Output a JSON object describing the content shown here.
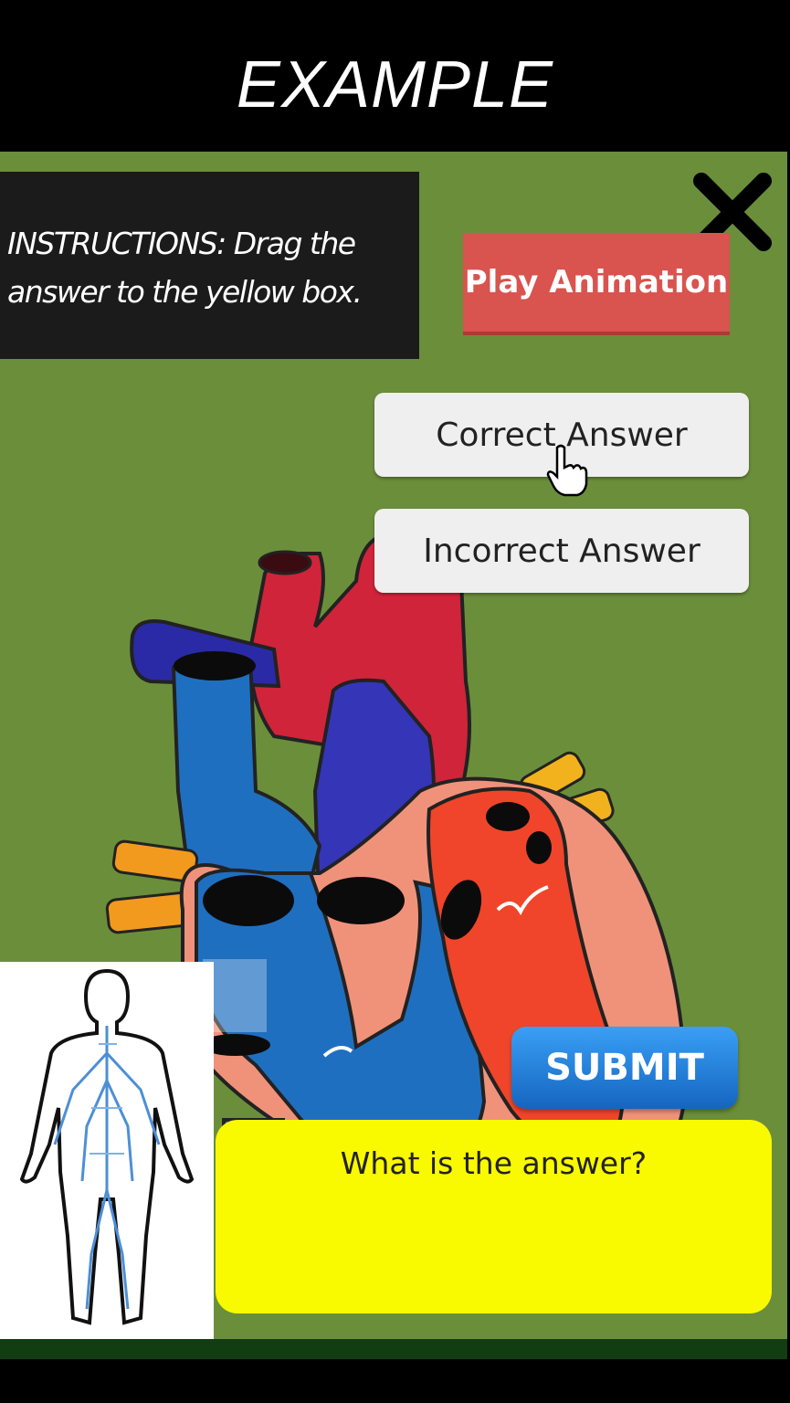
{
  "banner": {
    "title": "EXAMPLE"
  },
  "quiz": {
    "instructions": "INSTRUCTIONS: Drag the answer to the yellow box.",
    "play_button_label": "Play Animation",
    "close_icon": "close-icon",
    "answers": [
      {
        "label": "Correct Answer"
      },
      {
        "label": "Incorrect Answer"
      }
    ],
    "submit_label": "SUBMIT",
    "drop_box_text": "What is the answer?"
  },
  "colors": {
    "stage_background": "#6b8e3b",
    "play_button": "#d9534f",
    "submit_button": "#1e88e5",
    "drop_box": "#f9f900"
  }
}
